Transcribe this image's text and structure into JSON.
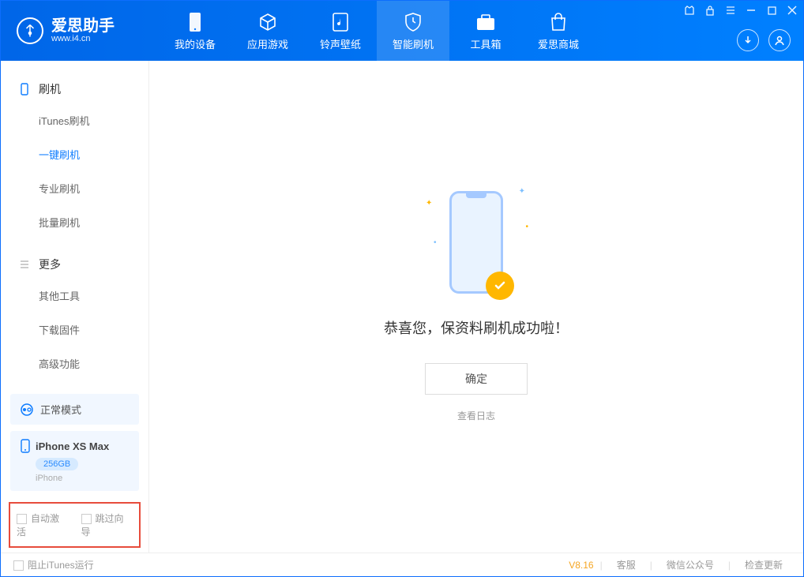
{
  "app": {
    "name": "爱思助手",
    "url": "www.i4.cn"
  },
  "nav": [
    {
      "label": "我的设备"
    },
    {
      "label": "应用游戏"
    },
    {
      "label": "铃声壁纸"
    },
    {
      "label": "智能刷机"
    },
    {
      "label": "工具箱"
    },
    {
      "label": "爱思商城"
    }
  ],
  "sidebar": {
    "section1": {
      "title": "刷机",
      "items": [
        "iTunes刷机",
        "一键刷机",
        "专业刷机",
        "批量刷机"
      ]
    },
    "section2": {
      "title": "更多",
      "items": [
        "其他工具",
        "下载固件",
        "高级功能"
      ]
    },
    "mode": "正常模式",
    "device": {
      "name": "iPhone XS Max",
      "storage": "256GB",
      "type": "iPhone"
    },
    "check1": "自动激活",
    "check2": "跳过向导"
  },
  "main": {
    "success": "恭喜您，保资料刷机成功啦！",
    "ok": "确定",
    "viewlog": "查看日志"
  },
  "footer": {
    "block": "阻止iTunes运行",
    "version": "V8.16",
    "links": [
      "客服",
      "微信公众号",
      "检查更新"
    ]
  }
}
